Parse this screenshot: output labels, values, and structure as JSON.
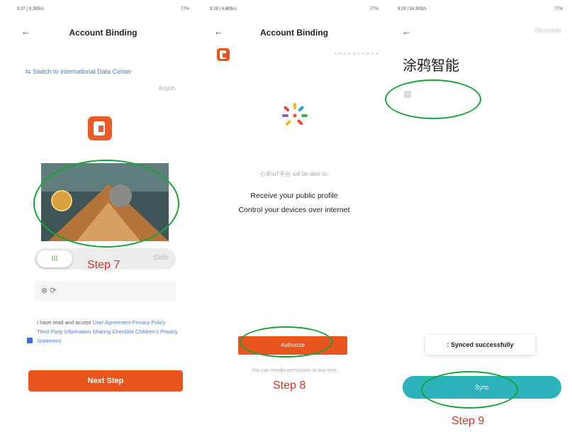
{
  "panel1": {
    "status_left": "9:27 | 9.2KB/s",
    "status_right": "77%",
    "back_icon": "arrow-left-icon",
    "title": "Account Binding",
    "switch_data_center": "⇆ Switch to International Data Center",
    "language": "English",
    "logo_icon": "tuya-logo-icon",
    "slider_handle_glyph": "III",
    "slider_hint": "Slide",
    "code_icons": "⊗ ⟳",
    "agreement_prefix": "I have read and accept ",
    "agreement_links": "User Agreement Privacy Policy Third Party Information Sharing Checklist Children's Privacy Statement",
    "next_step": "Next Step"
  },
  "panel2": {
    "status_left": "9:28 | 4.8KB/s",
    "status_right": "77%",
    "back_icon": "arrow-left-icon",
    "title": "Account Binding",
    "account_masked": "- - - - - - - - - -",
    "grant_line": "小米IoT平台 will be able to:",
    "permission_profile": "Receive your public profile",
    "permission_devices": "Control your devices over internet",
    "authorize": "Authorize",
    "revoke_note": "You can revoke permission at any time"
  },
  "panel3": {
    "status_left": "9:28 | 34.3KB/s",
    "status_right": "77%",
    "back_icon": "arrow-left-icon",
    "remove": "Remove",
    "brand_title": "涂鸦智能",
    "toast": ": Synced successfully",
    "sync": "Sync"
  },
  "annotations": {
    "step7": "Step 7",
    "step8": "Step 8",
    "step9": "Step 9",
    "highlight_color": "#1aa33a",
    "step_color": "#d9322a"
  },
  "colors": {
    "tuya_orange": "#e8551f",
    "link_blue": "#4b7fd6",
    "sync_teal": "#2cb3bb"
  }
}
